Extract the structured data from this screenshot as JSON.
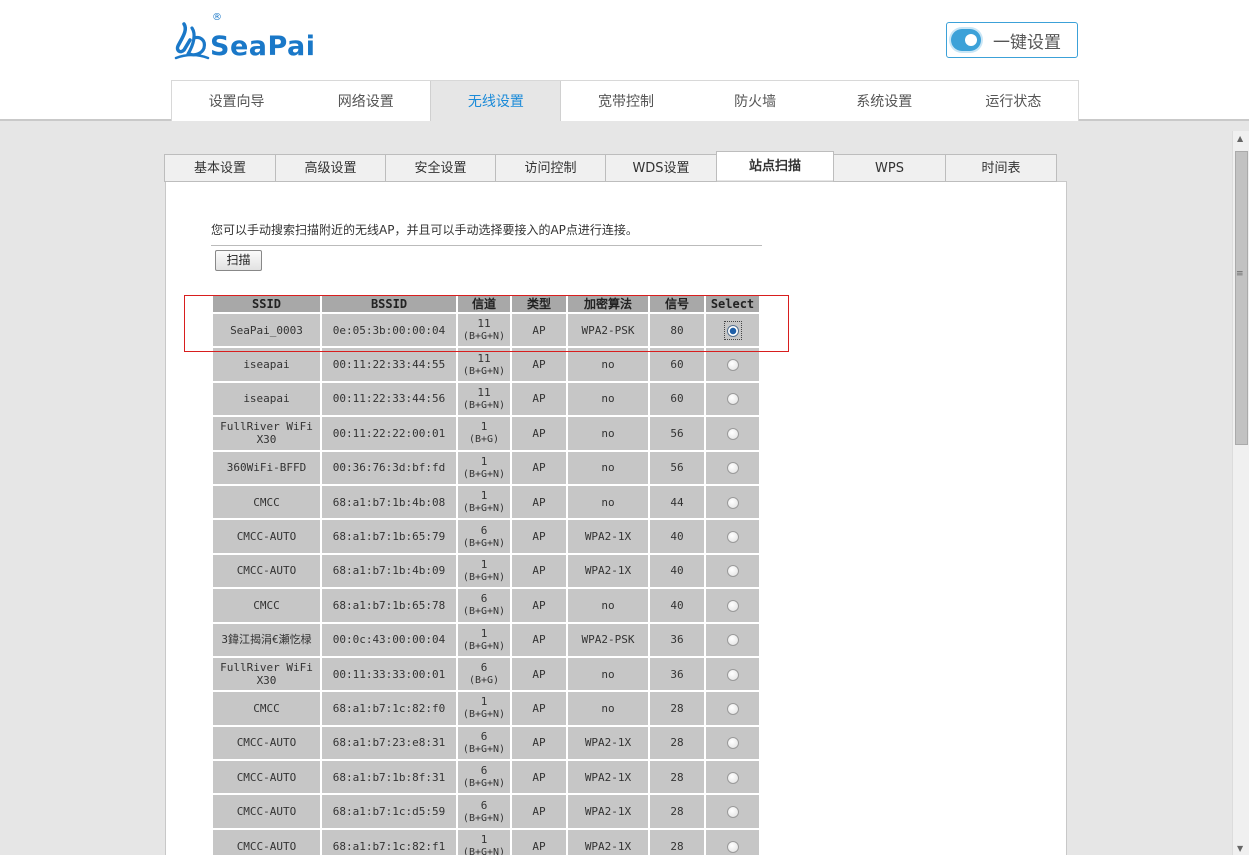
{
  "brand": {
    "name": "SeaPai",
    "reg_mark": "®"
  },
  "quick_setup": {
    "label": "一键设置"
  },
  "main_nav": [
    {
      "label": "设置向导",
      "active": false
    },
    {
      "label": "网络设置",
      "active": false
    },
    {
      "label": "无线设置",
      "active": true
    },
    {
      "label": "宽带控制",
      "active": false
    },
    {
      "label": "防火墙",
      "active": false
    },
    {
      "label": "系统设置",
      "active": false
    },
    {
      "label": "运行状态",
      "active": false
    }
  ],
  "sub_tabs": [
    {
      "label": "基本设置",
      "active": false
    },
    {
      "label": "高级设置",
      "active": false
    },
    {
      "label": "安全设置",
      "active": false
    },
    {
      "label": "访问控制",
      "active": false
    },
    {
      "label": "WDS设置",
      "active": false
    },
    {
      "label": "站点扫描",
      "active": true
    },
    {
      "label": "WPS",
      "active": false
    },
    {
      "label": "时间表",
      "active": false
    }
  ],
  "intro": "您可以手动搜索扫描附近的无线AP，并且可以手动选择要接入的AP点进行连接。",
  "scan_button": "扫描",
  "table": {
    "headers": [
      "SSID",
      "BSSID",
      "信道",
      "类型",
      "加密算法",
      "信号",
      "Select"
    ],
    "rows": [
      {
        "ssid": "SeaPai_0003",
        "bssid": "0e:05:3b:00:00:04",
        "channel": "11",
        "mode": "(B+G+N)",
        "type": "AP",
        "enc": "WPA2-PSK",
        "signal": "80",
        "selected": true
      },
      {
        "ssid": "iseapai",
        "bssid": "00:11:22:33:44:55",
        "channel": "11",
        "mode": "(B+G+N)",
        "type": "AP",
        "enc": "no",
        "signal": "60",
        "selected": false
      },
      {
        "ssid": "iseapai",
        "bssid": "00:11:22:33:44:56",
        "channel": "11",
        "mode": "(B+G+N)",
        "type": "AP",
        "enc": "no",
        "signal": "60",
        "selected": false
      },
      {
        "ssid": "FullRiver WiFi X30",
        "bssid": "00:11:22:22:00:01",
        "channel": "1",
        "mode": "(B+G)",
        "type": "AP",
        "enc": "no",
        "signal": "56",
        "selected": false
      },
      {
        "ssid": "360WiFi-BFFD",
        "bssid": "00:36:76:3d:bf:fd",
        "channel": "1",
        "mode": "(B+G+N)",
        "type": "AP",
        "enc": "no",
        "signal": "56",
        "selected": false
      },
      {
        "ssid": "CMCC",
        "bssid": "68:a1:b7:1b:4b:08",
        "channel": "1",
        "mode": "(B+G+N)",
        "type": "AP",
        "enc": "no",
        "signal": "44",
        "selected": false
      },
      {
        "ssid": "CMCC-AUTO",
        "bssid": "68:a1:b7:1b:65:79",
        "channel": "6",
        "mode": "(B+G+N)",
        "type": "AP",
        "enc": "WPA2-1X",
        "signal": "40",
        "selected": false
      },
      {
        "ssid": "CMCC-AUTO",
        "bssid": "68:a1:b7:1b:4b:09",
        "channel": "1",
        "mode": "(B+G+N)",
        "type": "AP",
        "enc": "WPA2-1X",
        "signal": "40",
        "selected": false
      },
      {
        "ssid": "CMCC",
        "bssid": "68:a1:b7:1b:65:78",
        "channel": "6",
        "mode": "(B+G+N)",
        "type": "AP",
        "enc": "no",
        "signal": "40",
        "selected": false
      },
      {
        "ssid": "3鍏江揭涓€瀬忔椂",
        "bssid": "00:0c:43:00:00:04",
        "channel": "1",
        "mode": "(B+G+N)",
        "type": "AP",
        "enc": "WPA2-PSK",
        "signal": "36",
        "selected": false
      },
      {
        "ssid": "FullRiver WiFi X30",
        "bssid": "00:11:33:33:00:01",
        "channel": "6",
        "mode": "(B+G)",
        "type": "AP",
        "enc": "no",
        "signal": "36",
        "selected": false
      },
      {
        "ssid": "CMCC",
        "bssid": "68:a1:b7:1c:82:f0",
        "channel": "1",
        "mode": "(B+G+N)",
        "type": "AP",
        "enc": "no",
        "signal": "28",
        "selected": false
      },
      {
        "ssid": "CMCC-AUTO",
        "bssid": "68:a1:b7:23:e8:31",
        "channel": "6",
        "mode": "(B+G+N)",
        "type": "AP",
        "enc": "WPA2-1X",
        "signal": "28",
        "selected": false
      },
      {
        "ssid": "CMCC-AUTO",
        "bssid": "68:a1:b7:1b:8f:31",
        "channel": "6",
        "mode": "(B+G+N)",
        "type": "AP",
        "enc": "WPA2-1X",
        "signal": "28",
        "selected": false
      },
      {
        "ssid": "CMCC-AUTO",
        "bssid": "68:a1:b7:1c:d5:59",
        "channel": "6",
        "mode": "(B+G+N)",
        "type": "AP",
        "enc": "WPA2-1X",
        "signal": "28",
        "selected": false
      },
      {
        "ssid": "CMCC-AUTO",
        "bssid": "68:a1:b7:1c:82:f1",
        "channel": "1",
        "mode": "(B+G+N)",
        "type": "AP",
        "enc": "WPA2-1X",
        "signal": "28",
        "selected": false
      }
    ]
  },
  "colors": {
    "accent": "#1a8ad8",
    "highlight_border": "#d81e1e",
    "brand": "#1a78c8"
  }
}
